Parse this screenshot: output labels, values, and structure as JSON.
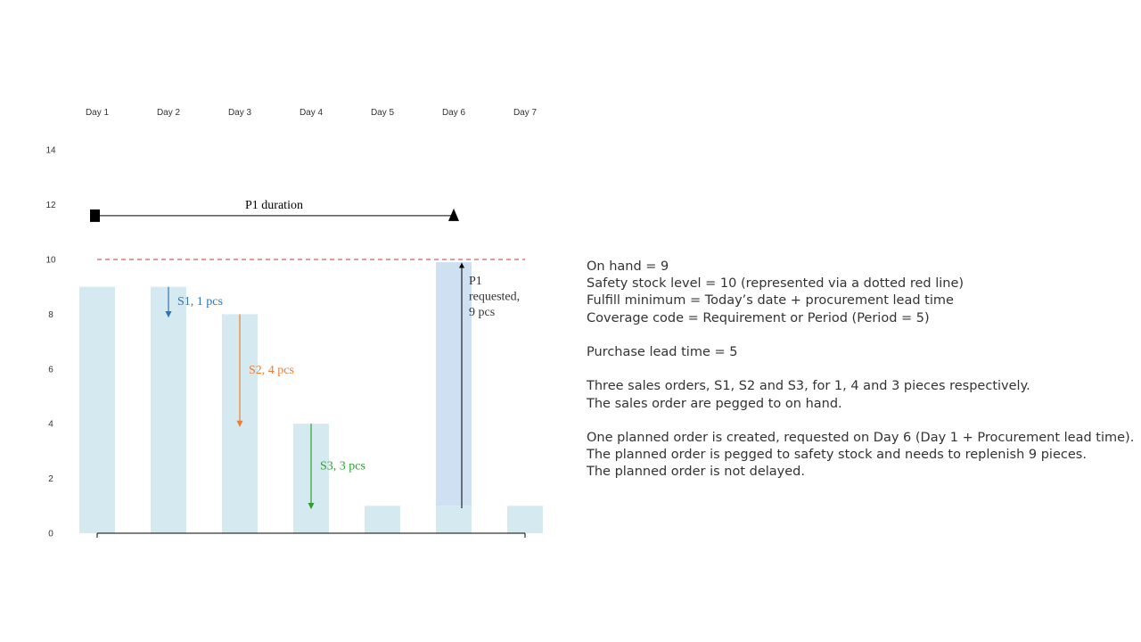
{
  "chart_data": {
    "type": "bar",
    "categories": [
      "Day 1",
      "Day 2",
      "Day 3",
      "Day 4",
      "Day 5",
      "Day 6",
      "Day 7"
    ],
    "values": [
      9,
      9,
      8,
      4,
      1,
      1,
      1
    ],
    "planned_order": {
      "category": "Day 6",
      "from": 0,
      "to": 9.9,
      "label_lines": [
        "P1",
        "requested,",
        "9 pcs"
      ],
      "color": "#cfe0f2"
    },
    "yticks": [
      0,
      2,
      4,
      6,
      8,
      10,
      12,
      14
    ],
    "ylim": [
      0,
      14
    ],
    "safety_stock": {
      "value": 10,
      "color": "#c0392b"
    },
    "duration": {
      "label": "P1 duration",
      "value": 11.6,
      "from_category": "Day 1",
      "to_category": "Day 6"
    },
    "sales_orders": [
      {
        "label": "S1, 1 pcs",
        "category": "Day 2",
        "from": 9,
        "to": 8,
        "color": "#2e75b6"
      },
      {
        "label": "S2, 4 pcs",
        "category": "Day 3",
        "from": 8,
        "to": 4,
        "color": "#ed7d31"
      },
      {
        "label": "S3, 3 pcs",
        "category": "Day 4",
        "from": 4,
        "to": 1,
        "color": "#2ca02c"
      }
    ],
    "bar_color": "#d5eaf0"
  },
  "notes": [
    "On hand = 9",
    "Safety stock level = 10 (represented via a dotted red line)",
    "Fulfill minimum = Today’s date + procurement lead time",
    "Coverage code = Requirement or Period (Period = 5)",
    "",
    "Purchase lead time = 5",
    "",
    "Three sales orders, S1, S2 and S3, for 1, 4 and 3 pieces respectively.",
    "The sales order are pegged to on hand.",
    "",
    "One planned order is created, requested on Day 6 (Day 1 + Procurement lead time).",
    "The planned order is pegged to safety stock and needs to replenish 9 pieces.",
    "The planned order is not delayed."
  ]
}
